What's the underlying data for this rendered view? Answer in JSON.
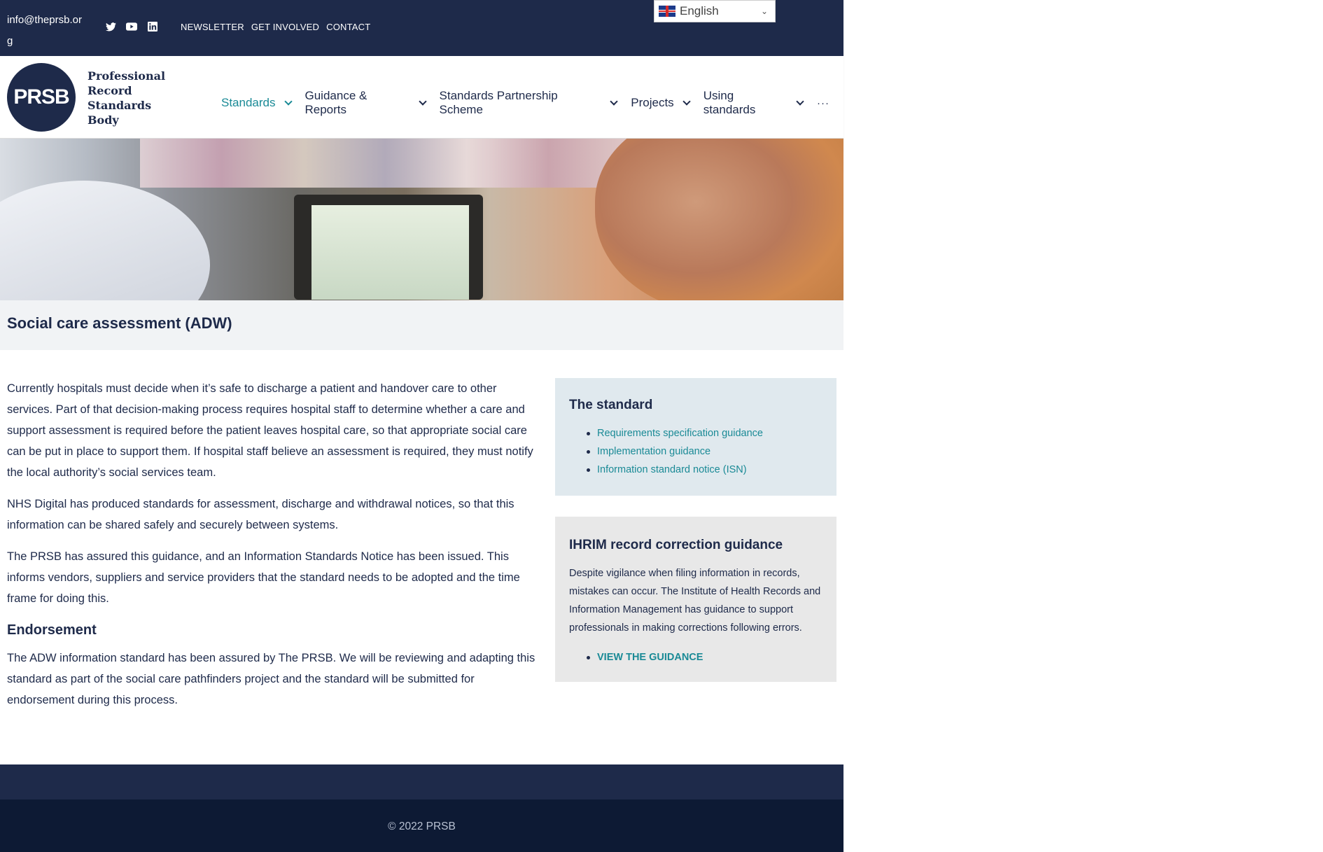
{
  "topbar": {
    "email": "info@theprsb.org",
    "social_icons": [
      "twitter-icon",
      "youtube-icon",
      "linkedin-icon"
    ],
    "links": [
      "NEWSLETTER",
      "GET INVOLVED",
      "CONTACT"
    ]
  },
  "language": {
    "selected": "English",
    "flag": "uk-flag-icon"
  },
  "logo": {
    "mark": "PRSB",
    "line1": "Professional",
    "line2": "Record",
    "line3": "Standards",
    "line4": "Body"
  },
  "nav": {
    "items": [
      {
        "label": "Standards",
        "active": true
      },
      {
        "label": "Guidance & Reports"
      },
      {
        "label": "Standards Partnership Scheme"
      },
      {
        "label": "Projects"
      },
      {
        "label": "Using standards"
      }
    ],
    "more": "···"
  },
  "page": {
    "title": "Social care assessment (ADW)",
    "paragraphs": [
      "Currently hospitals must decide when it’s safe to discharge a patient and handover care to other services. Part of that decision-making process requires hospital staff to determine whether a care and support assessment is required before the patient leaves hospital care, so that appropriate social care can be put in place to support them. If hospital staff believe an assessment is required, they must notify the local authority’s social services team.",
      "NHS Digital has produced standards for assessment, discharge and withdrawal notices, so that this information can be shared safely and securely between systems.",
      "The PRSB has assured this guidance, and an Information Standards Notice has been issued. This informs vendors, suppliers and service providers that the standard needs to be adopted and the time frame for doing this."
    ],
    "endorsement_heading": "Endorsement",
    "endorsement_text": "The ADW information standard has been assured by The PRSB. We will be reviewing and adapting this standard as part of the social care pathfinders project and the standard will be submitted for endorsement during this process."
  },
  "sidebar": {
    "standard_heading": "The standard",
    "standard_links": [
      "Requirements specification guidance",
      "Implementation guidance",
      "Information standard notice (ISN)"
    ],
    "ihrim_heading": "IHRIM record correction guidance",
    "ihrim_text": "Despite vigilance when filing information in records, mistakes can occur. The Institute of Health Records and Information Management has guidance to support professionals in making corrections following errors.",
    "ihrim_link": "VIEW THE GUIDANCE"
  },
  "footer": {
    "copyright": "© 2022 PRSB"
  },
  "colors": {
    "navy": "#1e2a4a",
    "teal": "#1a8a96",
    "footer_dark": "#0d1a34"
  }
}
